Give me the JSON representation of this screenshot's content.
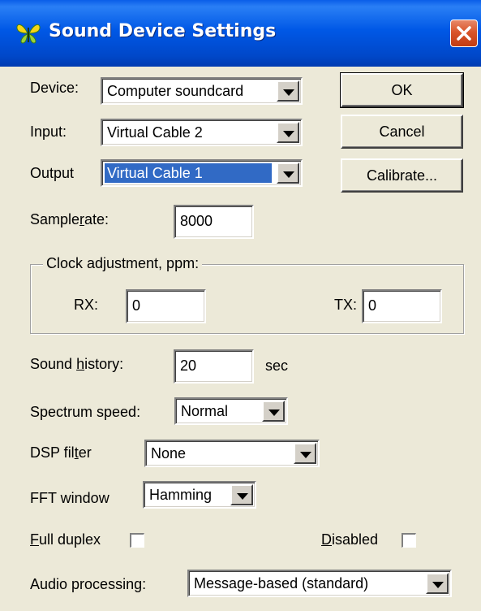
{
  "window": {
    "title": "Sound Device Settings",
    "icon": "butterfly-icon",
    "close_icon": "close-icon"
  },
  "device": {
    "label": "Device:",
    "value": "Computer soundcard"
  },
  "input": {
    "label": "Input:",
    "value": "Virtual Cable 2"
  },
  "output": {
    "label": "Output",
    "value": "Virtual Cable 1"
  },
  "buttons": {
    "ok": "OK",
    "cancel": "Cancel",
    "calibrate": "Calibrate..."
  },
  "samplerate": {
    "label_pre": "Sample",
    "label_accel": "r",
    "label_post": "ate:",
    "value": "8000"
  },
  "clock": {
    "group_label": "Clock adjustment, ppm:",
    "rx_label": "RX:",
    "rx_value": "0",
    "tx_label": "TX:",
    "tx_value": "0"
  },
  "sound_history": {
    "label_pre": "Sound ",
    "label_accel": "h",
    "label_post": "istory:",
    "value": "20",
    "unit": "sec"
  },
  "spectrum_speed": {
    "label": "Spectrum speed:",
    "value": "Normal"
  },
  "dsp_filter": {
    "label_pre": "DSP fil",
    "label_accel": "t",
    "label_post": "er",
    "value": "None"
  },
  "fft_window": {
    "label": "FFT window",
    "value": "Hamming"
  },
  "full_duplex": {
    "label_accel": "F",
    "label_post": "ull duplex",
    "checked": false
  },
  "disabled": {
    "label_accel": "D",
    "label_post": "isabled",
    "checked": false
  },
  "audio_processing": {
    "label": "Audio processing:",
    "value": "Message-based (standard)"
  },
  "colors": {
    "titlebar": "#0058e6",
    "dialog_bg": "#ece9d8",
    "selection": "#316ac5",
    "close_button": "#d9552a"
  }
}
